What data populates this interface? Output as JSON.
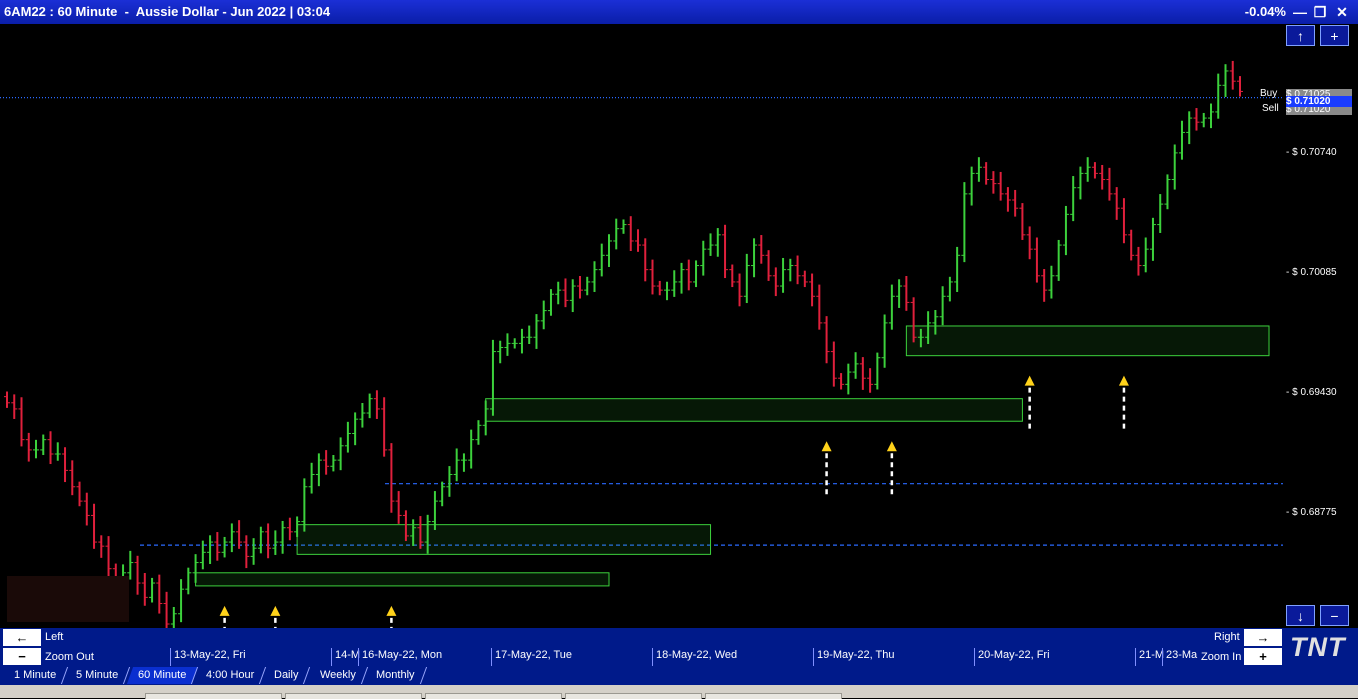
{
  "window": {
    "title": "6AM22 : 60 Minute  -  Aussie Dollar - Jun 2022 | 03:04",
    "change": "-0.04%",
    "minimize": "—",
    "restore": "❐",
    "close": "✕"
  },
  "side": {
    "up": "↑",
    "plus": "+",
    "down": "↓",
    "minus": "−"
  },
  "price_axis": {
    "buy_label": "Buy",
    "sell_label": "Sell",
    "buy_price": "$ 0.71025",
    "last_price": "$ 0.71020",
    "sell_price": "$ 0.71020",
    "ticks": [
      "- $ 0.70740",
      "- $ 0.70085",
      "- $ 0.69430",
      "- $ 0.68775"
    ]
  },
  "nav": {
    "left_label": "Left",
    "left_arrow": "←",
    "right_label": "Right",
    "right_arrow": "→",
    "zoom_out_label": "Zoom Out",
    "zoom_out_symbol": "−",
    "zoom_in_label": "Zoom In",
    "zoom_in_symbol": "+",
    "logo": "TNT"
  },
  "date_labels": [
    "13-May-22, Fri",
    "14-M",
    "16-May-22, Mon",
    "17-May-22, Tue",
    "18-May-22, Wed",
    "19-May-22, Thu",
    "20-May-22, Fri",
    "21-M",
    "23-Ma"
  ],
  "timeframe_tabs": [
    "1 Minute",
    "5 Minute",
    "60 Minute",
    "4:00 Hour",
    "Daily",
    "Weekly",
    "Monthly"
  ],
  "colors": {
    "up": "#3cd13c",
    "down": "#e0203c",
    "zone": "#3cd13c",
    "level": "#2a6aff",
    "arrow": "#ffd21a",
    "title_bg": "#0a1ea8"
  },
  "chart_data": {
    "type": "ohlc",
    "ylim": [
      0.6845,
      0.7135
    ],
    "levels": [
      0.69135,
      0.68835,
      0.7102
    ],
    "zones": [
      {
        "from_bar": 26,
        "to_bar": 83,
        "low": 0.68636,
        "high": 0.687
      },
      {
        "from_bar": 40,
        "to_bar": 97,
        "low": 0.6879,
        "high": 0.68935
      },
      {
        "from_bar": 66,
        "to_bar": 140,
        "low": 0.6944,
        "high": 0.6955
      },
      {
        "from_bar": 124,
        "to_bar": 174,
        "low": 0.6976,
        "high": 0.69905
      }
    ],
    "arrow_bars": [
      30,
      37,
      53,
      113,
      122,
      141,
      154
    ],
    "closes": [
      0.6953,
      0.695,
      0.6935,
      0.693,
      0.693,
      0.6935,
      0.6928,
      0.6928,
      0.692,
      0.6912,
      0.6905,
      0.6898,
      0.6885,
      0.6883,
      0.6872,
      0.6865,
      0.687,
      0.6875,
      0.6865,
      0.6858,
      0.6865,
      0.6855,
      0.6845,
      0.685,
      0.6862,
      0.687,
      0.6875,
      0.688,
      0.6885,
      0.688,
      0.6885,
      0.689,
      0.6885,
      0.6878,
      0.6882,
      0.689,
      0.6882,
      0.6885,
      0.6892,
      0.689,
      0.6895,
      0.6912,
      0.6918,
      0.6925,
      0.6922,
      0.6925,
      0.6932,
      0.6938,
      0.6945,
      0.6948,
      0.6955,
      0.695,
      0.693,
      0.6905,
      0.6898,
      0.6888,
      0.6892,
      0.6885,
      0.6895,
      0.6905,
      0.6912,
      0.6918,
      0.6925,
      0.6925,
      0.6935,
      0.6942,
      0.695,
      0.6978,
      0.698,
      0.6982,
      0.6982,
      0.6985,
      0.6985,
      0.6993,
      0.6998,
      0.7006,
      0.7008,
      0.7003,
      0.701,
      0.7008,
      0.7012,
      0.7018,
      0.7025,
      0.7032,
      0.7038,
      0.704,
      0.7032,
      0.703,
      0.7018,
      0.701,
      0.7008,
      0.7008,
      0.7012,
      0.7018,
      0.7012,
      0.702,
      0.7028,
      0.703,
      0.7035,
      0.7018,
      0.7012,
      0.7005,
      0.702,
      0.703,
      0.7025,
      0.7015,
      0.701,
      0.7018,
      0.702,
      0.7015,
      0.7012,
      0.7005,
      0.6992,
      0.6978,
      0.6965,
      0.6962,
      0.6968,
      0.6972,
      0.6965,
      0.6962,
      0.6975,
      0.6992,
      0.7005,
      0.701,
      0.7002,
      0.6985,
      0.6985,
      0.6992,
      0.6995,
      0.7005,
      0.7012,
      0.7025,
      0.7055,
      0.7065,
      0.7068,
      0.7062,
      0.706,
      0.7055,
      0.7052,
      0.7048,
      0.7035,
      0.7028,
      0.7015,
      0.7008,
      0.7015,
      0.703,
      0.7045,
      0.7058,
      0.7065,
      0.7068,
      0.7065,
      0.7062,
      0.7055,
      0.7048,
      0.7035,
      0.7025,
      0.702,
      0.7028,
      0.704,
      0.705,
      0.7062,
      0.7075,
      0.7085,
      0.7092,
      0.709,
      0.7092,
      0.7095,
      0.7108,
      0.7115,
      0.711,
      0.7105
    ]
  }
}
